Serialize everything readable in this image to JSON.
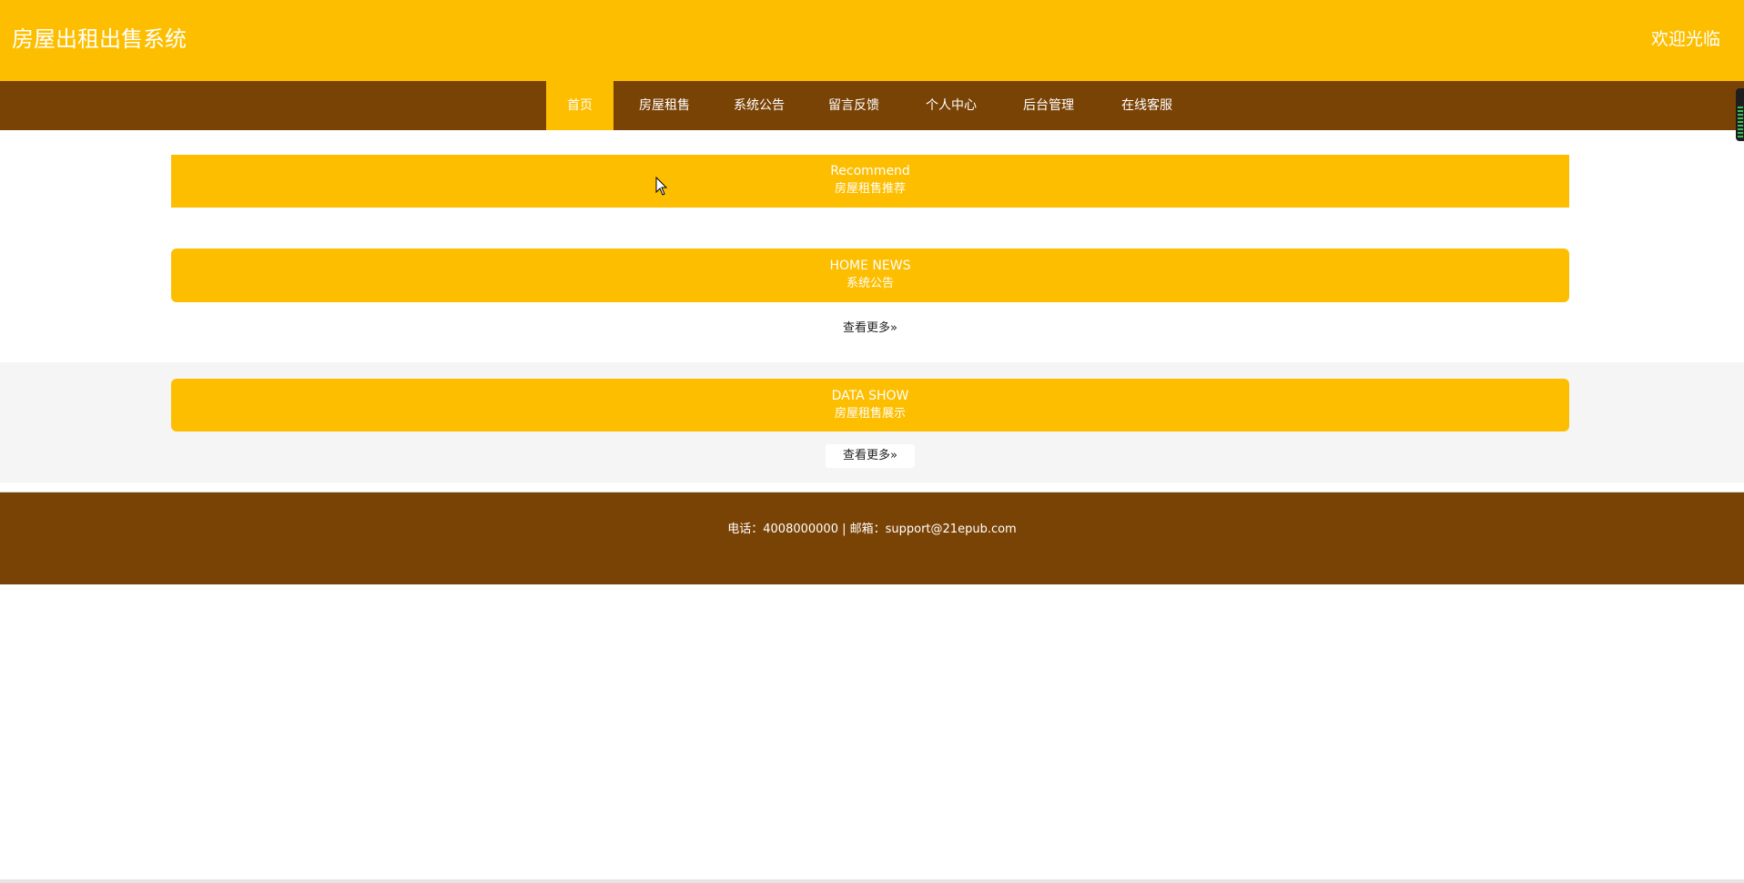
{
  "header": {
    "site_title": "房屋出租出售系统",
    "welcome": "欢迎光临"
  },
  "nav": {
    "items": [
      {
        "label": "首页",
        "active": true
      },
      {
        "label": "房屋租售"
      },
      {
        "label": "系统公告"
      },
      {
        "label": "留言反馈"
      },
      {
        "label": "个人中心"
      },
      {
        "label": "后台管理"
      },
      {
        "label": "在线客服"
      }
    ]
  },
  "sections": {
    "recommend": {
      "title_en": "Recommend",
      "title_zh": "房屋租售推荐"
    },
    "news": {
      "title_en": "HOME NEWS",
      "title_zh": "系统公告",
      "more": "查看更多»"
    },
    "data_show": {
      "title_en": "DATA SHOW",
      "title_zh": "房屋租售展示",
      "more": "查看更多»"
    }
  },
  "footer": {
    "contact": "电话：4008000000 | 邮箱：support@21epub.com"
  },
  "colors": {
    "primary": "#fdbe00",
    "nav_bg": "#7a4306",
    "section_gray": "#f5f5f5"
  }
}
